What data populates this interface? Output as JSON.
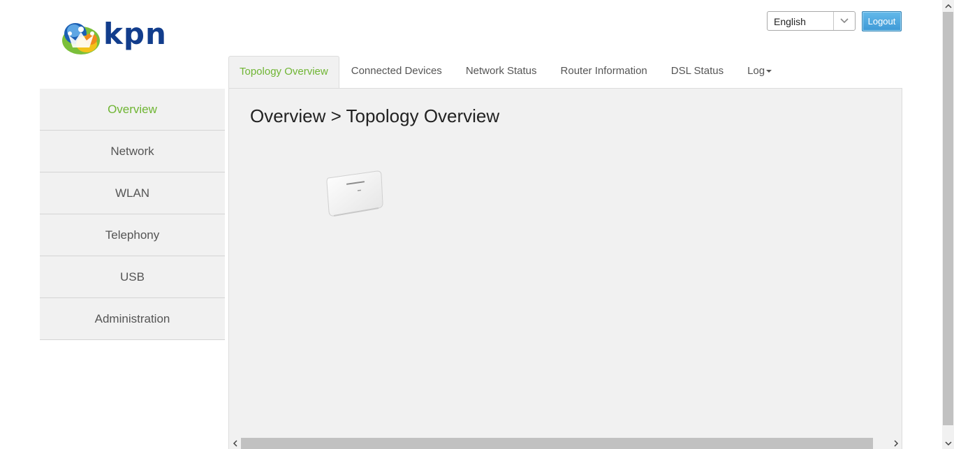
{
  "brand": {
    "logo_text": "kpn",
    "colors": {
      "brand_blue": "#123d8c",
      "accent_green": "#6fb533",
      "button_blue": "#3d99d6"
    }
  },
  "header": {
    "language_selected": "English",
    "logout_label": "Logout"
  },
  "tabs": [
    {
      "label": "Topology Overview",
      "active": true
    },
    {
      "label": "Connected Devices",
      "active": false
    },
    {
      "label": "Network Status",
      "active": false
    },
    {
      "label": "Router Information",
      "active": false
    },
    {
      "label": "DSL Status",
      "active": false
    },
    {
      "label": "Log",
      "active": false
    }
  ],
  "sidebar": {
    "items": [
      {
        "label": "Overview",
        "active": true
      },
      {
        "label": "Network",
        "active": false
      },
      {
        "label": "WLAN",
        "active": false
      },
      {
        "label": "Telephony",
        "active": false
      },
      {
        "label": "USB",
        "active": false
      },
      {
        "label": "Administration",
        "active": false
      }
    ]
  },
  "main": {
    "title": "Overview > Topology Overview",
    "topology_device_icon": "router-icon"
  },
  "icons": {
    "language_dropdown": "chevron-down-icon",
    "log_dropdown": "caret-down-icon"
  }
}
